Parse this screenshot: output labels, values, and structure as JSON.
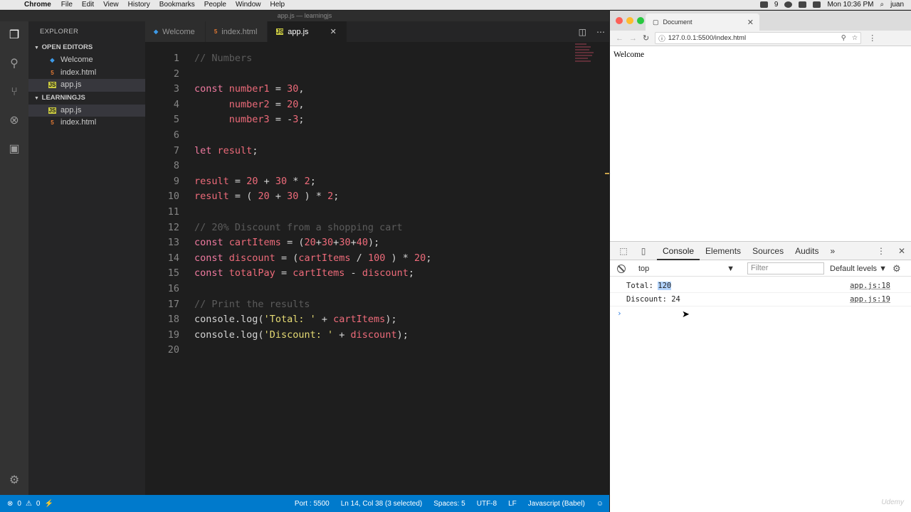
{
  "menubar": {
    "app_name": "Chrome",
    "items": [
      "File",
      "Edit",
      "View",
      "History",
      "Bookmarks",
      "People",
      "Window",
      "Help"
    ],
    "clock": "Mon 10:36 PM",
    "user": "juan",
    "battery_num": "9"
  },
  "vscode": {
    "window_title": "app.js — learningjs",
    "explorer_title": "EXPLORER",
    "open_editors_title": "OPEN EDITORS",
    "open_editors": [
      {
        "name": "Welcome",
        "icon": "vscode-icon"
      },
      {
        "name": "index.html",
        "icon": "html-icon"
      },
      {
        "name": "app.js",
        "icon": "js-icon"
      }
    ],
    "project_title": "LEARNINGJS",
    "project_files": [
      {
        "name": "app.js",
        "icon": "js-icon"
      },
      {
        "name": "index.html",
        "icon": "html-icon"
      }
    ],
    "tabs": [
      {
        "label": "Welcome",
        "icon": "vscode-icon"
      },
      {
        "label": "index.html",
        "icon": "html-icon"
      },
      {
        "label": "app.js",
        "icon": "js-icon",
        "active": true
      }
    ],
    "code_lines": [
      {
        "n": "1",
        "text": "// Numbers"
      },
      {
        "n": "2",
        "text": ""
      },
      {
        "n": "3",
        "text": "const number1 = 30,"
      },
      {
        "n": "4",
        "text": "      number2 = 20,"
      },
      {
        "n": "5",
        "text": "      number3 = -3;"
      },
      {
        "n": "6",
        "text": ""
      },
      {
        "n": "7",
        "text": "let result;"
      },
      {
        "n": "8",
        "text": ""
      },
      {
        "n": "9",
        "text": "result = 20 + 30 * 2;"
      },
      {
        "n": "10",
        "text": "result = ( 20 + 30 ) * 2;"
      },
      {
        "n": "11",
        "text": ""
      },
      {
        "n": "12",
        "text": "// 20% Discount from a shopping cart"
      },
      {
        "n": "13",
        "text": "const cartItems = (20+30+30+40);"
      },
      {
        "n": "14",
        "text": "const discount = (cartItems / 100 ) * 20;"
      },
      {
        "n": "15",
        "text": "const totalPay = cartItems - discount;"
      },
      {
        "n": "16",
        "text": ""
      },
      {
        "n": "17",
        "text": "// Print the results"
      },
      {
        "n": "18",
        "text": "console.log('Total: ' + cartItems);"
      },
      {
        "n": "19",
        "text": "console.log('Discount: ' + discount);"
      },
      {
        "n": "20",
        "text": ""
      }
    ],
    "status": {
      "errors": "0",
      "warnings": "0",
      "port": "Port : 5500",
      "position": "Ln 14, Col 38 (3 selected)",
      "spaces": "Spaces: 5",
      "encoding": "UTF-8",
      "eol": "LF",
      "language": "Javascript (Babel)"
    }
  },
  "chrome": {
    "tab_title": "Document",
    "url": "127.0.0.1:5500/index.html",
    "page_text": "Welcome",
    "devtools": {
      "tabs": [
        "Console",
        "Elements",
        "Sources",
        "Audits"
      ],
      "active_tab": "Console",
      "context": "top",
      "filter_placeholder": "Filter",
      "levels": "Default levels",
      "logs": [
        {
          "label": "Total: ",
          "value": "120",
          "source": "app.js:18"
        },
        {
          "label": "Discount: ",
          "value": "24",
          "source": "app.js:19"
        }
      ]
    }
  },
  "watermark": "Udemy"
}
